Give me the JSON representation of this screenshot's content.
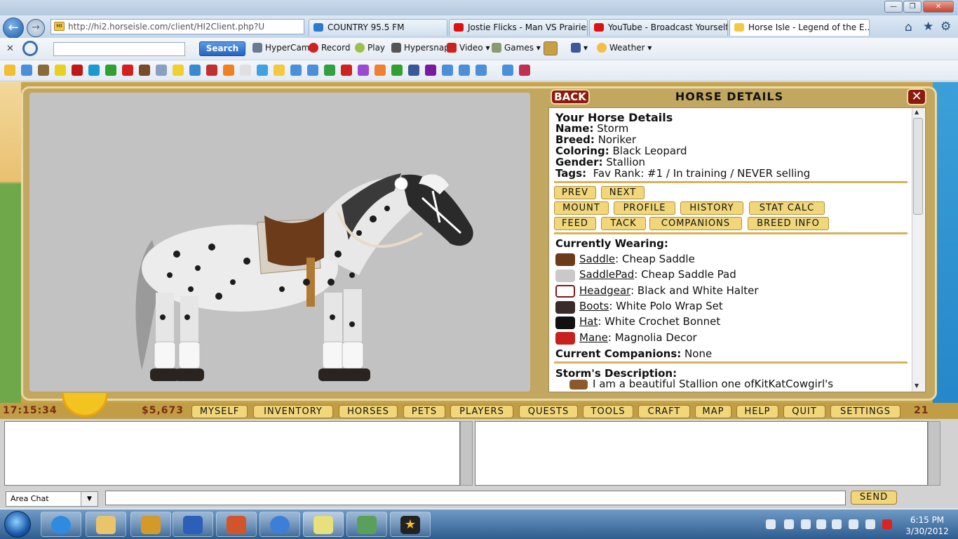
{
  "browser": {
    "address": "http://hi2.horseisle.com/client/HI2Client.php?U",
    "tabs": [
      {
        "label": "COUNTRY 95.5 FM",
        "icon": "ie-page-icon"
      },
      {
        "label": "Jostie Flicks - Man VS Prairies -...",
        "icon": "youtube-icon"
      },
      {
        "label": "YouTube - Broadcast Yourself.",
        "icon": "youtube-icon"
      },
      {
        "label": "Horse Isle - Legend of the E...",
        "icon": "horseisle-icon"
      }
    ],
    "toolbar": {
      "search_label": "Search",
      "hypercam": "HyperCam",
      "record": "Record",
      "play": "Play",
      "hypersnap": "Hypersnap",
      "video": "Video",
      "games": "Games",
      "weather": "Weather"
    }
  },
  "panel": {
    "back_label": "BACK",
    "title": "HORSE DETAILS",
    "close_label": "✕",
    "section_title": "Your Horse Details",
    "name_label": "Name:",
    "name": "Storm",
    "breed_label": "Breed:",
    "breed": "Noriker",
    "coloring_label": "Coloring:",
    "coloring": "Black Leopard",
    "gender_label": "Gender:",
    "gender": "Stallion",
    "tags_label": "Tags:",
    "tags": "Fav Rank: #1 / In training / NEVER selling",
    "buttons_row1": [
      "PREV",
      "NEXT"
    ],
    "buttons_row2": [
      "MOUNT",
      "PROFILE",
      "HISTORY",
      "STAT CALC"
    ],
    "buttons_row3": [
      "FEED",
      "TACK",
      "COMPANIONS",
      "BREED INFO"
    ],
    "wearing_title": "Currently Wearing:",
    "wearing": [
      {
        "slot": "Saddle",
        "item": ": Cheap Saddle",
        "icon": "saddle-icon",
        "color": "#6b3b1a"
      },
      {
        "slot": "SaddlePad",
        "item": ": Cheap Saddle Pad",
        "icon": "saddle-pad-icon",
        "color": "#c9c9c9"
      },
      {
        "slot": "Headgear",
        "item": ": Black and White Halter",
        "icon": "halter-icon",
        "color": "#ffffff"
      },
      {
        "slot": "Boots",
        "item": ": White Polo Wrap Set",
        "icon": "boots-icon",
        "color": "#3a2a2a"
      },
      {
        "slot": "Hat",
        "item": ": White Crochet Bonnet",
        "icon": "top-hat-icon",
        "color": "#111111"
      },
      {
        "slot": "Mane",
        "item": ": Magnolia Decor",
        "icon": "ribbon-icon",
        "color": "#c8201c"
      }
    ],
    "companions_label": "Current Companions:",
    "companions": "None",
    "description_title": "Storm's Description:",
    "description": "I am a beautiful Stallion one ofKitKatCowgirl's"
  },
  "gamebar": {
    "time": "17:15:34",
    "money": "$5,673",
    "menu": [
      "MYSELF",
      "INVENTORY",
      "HORSES",
      "PETS",
      "PLAYERS",
      "QUESTS",
      "TOOLS",
      "CRAFT",
      "MAP",
      "HELP",
      "QUIT",
      "SETTINGS"
    ],
    "count": "21"
  },
  "chat": {
    "channel": "Area Chat",
    "send_label": "SEND"
  },
  "taskbar": {
    "time": "6:15 PM",
    "date": "3/30/2012"
  },
  "colors": {
    "accent_gold": "#f1d77a",
    "panel_red": "#8c1a0e",
    "game_tan": "#c2a760"
  }
}
